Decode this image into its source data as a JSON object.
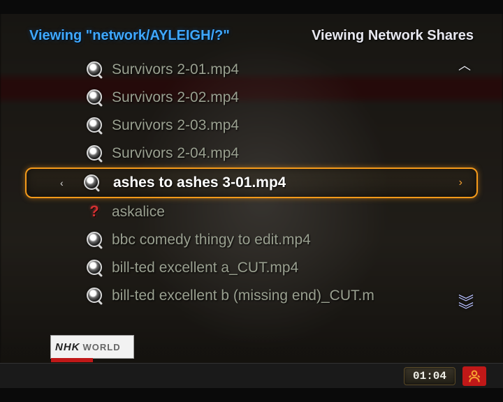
{
  "header": {
    "path": "Viewing \"network/AYLEIGH/?\"",
    "title": "Viewing Network Shares"
  },
  "list": {
    "selected_index": 4,
    "items": [
      {
        "icon": "file",
        "label": "Survivors 2-01.mp4"
      },
      {
        "icon": "file",
        "label": "Survivors 2-02.mp4"
      },
      {
        "icon": "file",
        "label": "Survivors 2-03.mp4"
      },
      {
        "icon": "file",
        "label": "Survivors 2-04.mp4"
      },
      {
        "icon": "file",
        "label": "ashes to ashes 3-01.mp4"
      },
      {
        "icon": "question",
        "label": "askalice"
      },
      {
        "icon": "file",
        "label": "bbc comedy thingy to edit.mp4"
      },
      {
        "icon": "file",
        "label": "bill-ted excellent a_CUT.mp4"
      },
      {
        "icon": "file",
        "label": "bill-ted excellent b (missing end)_CUT.m"
      }
    ]
  },
  "scroll": {
    "up_glyph": "︿",
    "down_glyph": "︾"
  },
  "logo": {
    "text1": "NHK",
    "text2": "WORLD"
  },
  "status": {
    "clock": "01:04"
  },
  "arrows": {
    "left": "‹",
    "right": "›"
  }
}
